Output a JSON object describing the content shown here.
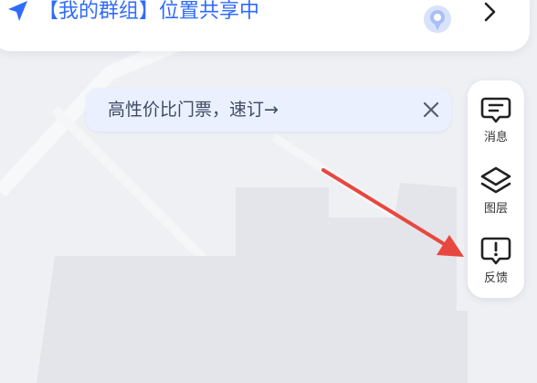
{
  "group_bar": {
    "text": "【我的群组】位置共享中",
    "nav_icon": "navigation-arrow-icon",
    "location_icon": "location-pin-icon",
    "chevron_icon": "chevron-right-icon",
    "accent_color": "#2f6bff"
  },
  "promo": {
    "text": "高性价比门票，速订→",
    "close_icon": "close-icon"
  },
  "side_panel": {
    "items": [
      {
        "label": "消息",
        "icon": "message-icon"
      },
      {
        "label": "图层",
        "icon": "layers-icon"
      },
      {
        "label": "反馈",
        "icon": "feedback-icon"
      }
    ]
  },
  "annotation": {
    "arrow_color": "#e8473f",
    "arrow_icon": "red-pointer-arrow"
  }
}
